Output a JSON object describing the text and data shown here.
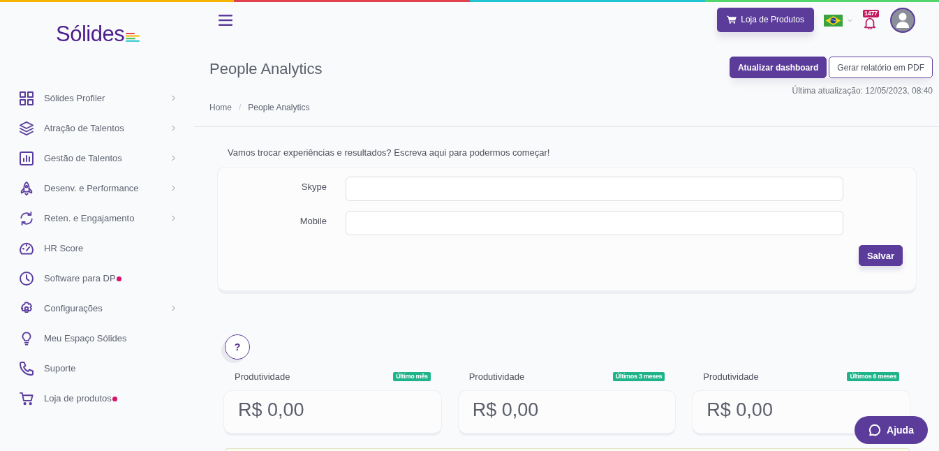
{
  "sidebar": {
    "logo": "Sólides",
    "items": [
      {
        "label": "Sólides Profiler",
        "expandable": true,
        "dot": false
      },
      {
        "label": "Atração de Talentos",
        "expandable": true,
        "dot": false
      },
      {
        "label": "Gestão de Talentos",
        "expandable": true,
        "dot": false
      },
      {
        "label": "Desenv. e Performance",
        "expandable": true,
        "dot": false
      },
      {
        "label": "Reten. e Engajamento",
        "expandable": true,
        "dot": false
      },
      {
        "label": "HR Score",
        "expandable": false,
        "dot": false
      },
      {
        "label": "Software para DP",
        "expandable": false,
        "dot": true
      },
      {
        "label": "Configurações",
        "expandable": true,
        "dot": false
      },
      {
        "label": "Meu Espaço Sólides",
        "expandable": false,
        "dot": false
      },
      {
        "label": "Suporte",
        "expandable": false,
        "dot": false
      },
      {
        "label": "Loja de produtos",
        "expandable": false,
        "dot": true
      }
    ]
  },
  "header": {
    "store_button": "Loja de Produtos",
    "notification_count": "1477"
  },
  "page_header": {
    "title": "People Analytics",
    "actions": [
      {
        "label": "Atualizar dashboard",
        "kind": "primary"
      },
      {
        "label": "Gerar relatório em PDF",
        "kind": "outline"
      }
    ],
    "last_update": "Última atualização: 12/05/2023, 08:40",
    "breadcrumb": {
      "separator": "/",
      "items": [
        {
          "label": "Home"
        },
        {
          "label": "People Analytics"
        }
      ]
    }
  },
  "contact_form": {
    "prompt": "Vamos trocar experiências e resultados? Escreva aqui para podermos começar!",
    "fields": [
      {
        "label": "Skype"
      },
      {
        "label": "Mobile"
      }
    ],
    "submit": "Salvar"
  },
  "help_button": "?",
  "metrics": [
    {
      "title": "Produtividade",
      "period": "Último mês",
      "value": "R$ 0,00"
    },
    {
      "title": "Produtividade",
      "period": "Últimos 3 meses",
      "value": "R$ 0,00"
    },
    {
      "title": "Produtividade",
      "period": "Últimos 6 meses",
      "value": "R$ 0,00"
    }
  ],
  "chat_button": "Ajuda"
}
